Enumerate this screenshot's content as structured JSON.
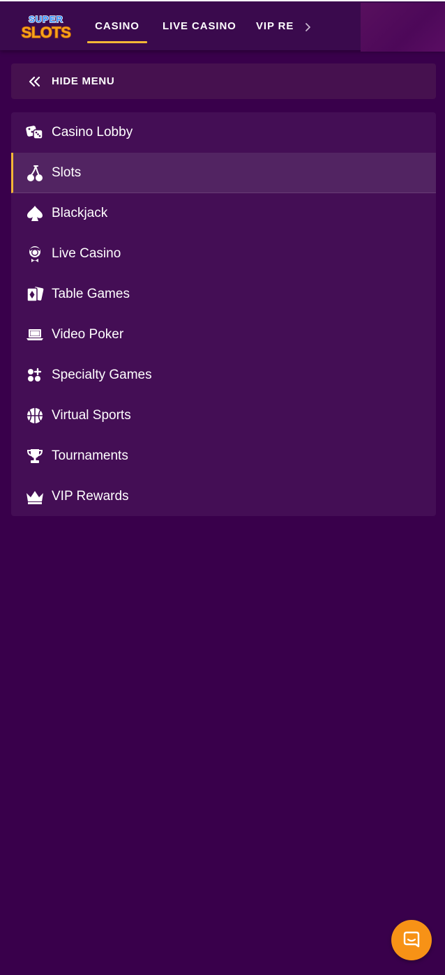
{
  "header": {
    "logo": {
      "line1": "SUPER",
      "line2": "SLOTS"
    },
    "tabs": [
      {
        "label": "CASINO",
        "active": true
      },
      {
        "label": "LIVE CASINO",
        "active": false
      },
      {
        "label": "VIP REWARDS",
        "active": false
      }
    ],
    "scroll_icon": "chevron-right-icon"
  },
  "hide_menu": {
    "label": "HIDE MENU",
    "icon": "double-chevron-left-icon"
  },
  "menu": {
    "items": [
      {
        "label": "Casino Lobby",
        "icon": "dice-icon",
        "active": false
      },
      {
        "label": "Slots",
        "icon": "cherry-icon",
        "active": true
      },
      {
        "label": "Blackjack",
        "icon": "spade-icon",
        "active": false
      },
      {
        "label": "Live Casino",
        "icon": "dealer-icon",
        "active": false
      },
      {
        "label": "Table Games",
        "icon": "playing-cards-icon",
        "active": false
      },
      {
        "label": "Video Poker",
        "icon": "laptop-icon",
        "active": false
      },
      {
        "label": "Specialty Games",
        "icon": "specialty-icon",
        "active": false
      },
      {
        "label": "Virtual Sports",
        "icon": "basketball-icon",
        "active": false
      },
      {
        "label": "Tournaments",
        "icon": "trophy-icon",
        "active": false
      },
      {
        "label": "VIP Rewards",
        "icon": "crown-icon",
        "active": false
      }
    ]
  },
  "chat": {
    "icon": "chat-icon"
  },
  "colors": {
    "background": "#39004b",
    "topbar": "#3a0a4d",
    "panel": "#440e55",
    "active_item": "#522462",
    "accent": "#f3b736",
    "chat_button": "#f79216"
  }
}
